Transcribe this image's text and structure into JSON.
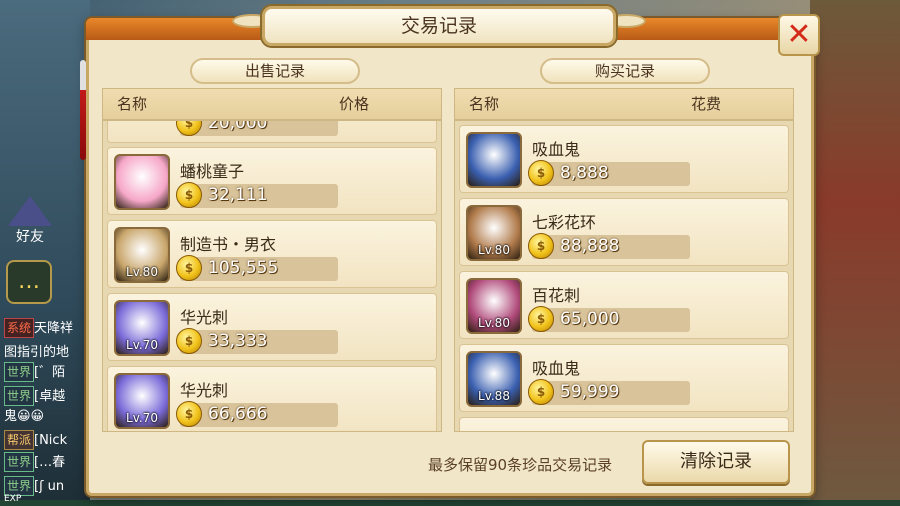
{
  "window": {
    "title": "交易记录"
  },
  "sell": {
    "section_title": "出售记录",
    "col_name": "名称",
    "col_price": "价格",
    "partial_top_price": "20,000",
    "items": [
      {
        "name": "蟠桃童子",
        "price": "32,111",
        "level": "",
        "icon": "peach-child-icon",
        "color": "#f6a7c8"
      },
      {
        "name": "制造书・男衣",
        "price": "105,555",
        "level": "Lv.80",
        "icon": "scroll-book-icon",
        "color": "#c9a66b"
      },
      {
        "name": "华光刺",
        "price": "33,333",
        "level": "Lv.70",
        "icon": "purple-blade-icon",
        "color": "#7a6ad8"
      },
      {
        "name": "华光刺",
        "price": "66,666",
        "level": "Lv.70",
        "icon": "purple-blade-icon",
        "color": "#7a6ad8"
      }
    ]
  },
  "buy": {
    "section_title": "购买记录",
    "col_name": "名称",
    "col_price": "花费",
    "items": [
      {
        "name": "吸血鬼",
        "price": "8,888",
        "level": "",
        "icon": "vampire-lantern-icon",
        "color": "#3a5fb0"
      },
      {
        "name": "七彩花环",
        "price": "88,888",
        "level": "Lv.80",
        "icon": "flower-wreath-icon",
        "color": "#b07a4a"
      },
      {
        "name": "百花刺",
        "price": "65,000",
        "level": "Lv.80",
        "icon": "flower-blade-icon",
        "color": "#b04a7a"
      },
      {
        "name": "吸血鬼",
        "price": "59,999",
        "level": "Lv.88",
        "icon": "vampire-lantern-icon",
        "color": "#3a5fb0"
      }
    ]
  },
  "footer": {
    "note": "最多保留90条珍品交易记录",
    "clear_label": "清除记录"
  },
  "close_icon": "close-icon",
  "background": {
    "friend_label": "好友",
    "chat": [
      {
        "tag": "系统",
        "text": "天降祥",
        "kind": "sys"
      },
      {
        "tag": "",
        "text": "图指引的地",
        "kind": ""
      },
      {
        "tag": "世界",
        "text": "[゛陌",
        "kind": "world"
      },
      {
        "tag": "世界",
        "text": "[卓越",
        "kind": "world"
      },
      {
        "tag": "",
        "text": "鬼😀😀",
        "kind": ""
      },
      {
        "tag": "帮派",
        "text": "[Nick",
        "kind": "gang"
      },
      {
        "tag": "世界",
        "text": "[…春",
        "kind": "world"
      },
      {
        "tag": "世界",
        "text": "[ʃ un",
        "kind": "world"
      }
    ],
    "exp_label": "EXP"
  }
}
